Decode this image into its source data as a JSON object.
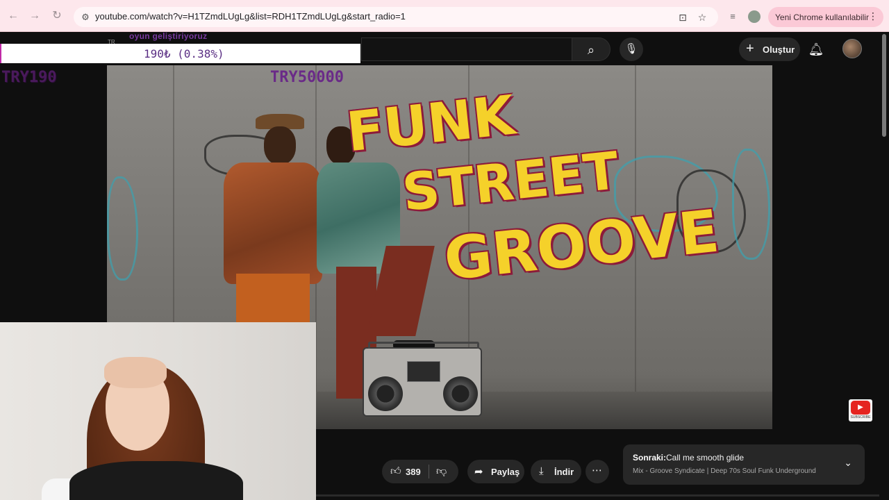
{
  "browser": {
    "url": "youtube.com/watch?v=H1TZmdLUgLg&list=RDH1TZmdLUgLg&start_radio=1",
    "chrome_pill_label": "Yeni Chrome kullanılabilir",
    "back_icon": "back-arrow",
    "forward_icon": "forward-arrow",
    "reload_icon": "reload"
  },
  "youtube": {
    "create_label": "Oluştur",
    "search_icon": "magnifier",
    "mic_icon": "microphone",
    "bell_icon": "bell"
  },
  "stream_overlay": {
    "progress_text": "190₺ (0.38%)",
    "goal_caption": "oyun geliştiriyoruz",
    "lang_tag": "TR",
    "current_amount": "TRY190",
    "goal_amount": "TRY50000"
  },
  "video": {
    "title_lines": [
      "FUNK",
      "STREET",
      "GROOVE"
    ],
    "subscribe_badge": "SUBSCRIBE"
  },
  "actions": {
    "like_count": "389",
    "share_label": "Paylaş",
    "download_label": "İndir"
  },
  "up_next": {
    "prefix": "Sonraki:",
    "title": "Call me smooth glide",
    "subtitle": "Mix - Groove Syndicate | Deep 70s Soul Funk Underground"
  }
}
